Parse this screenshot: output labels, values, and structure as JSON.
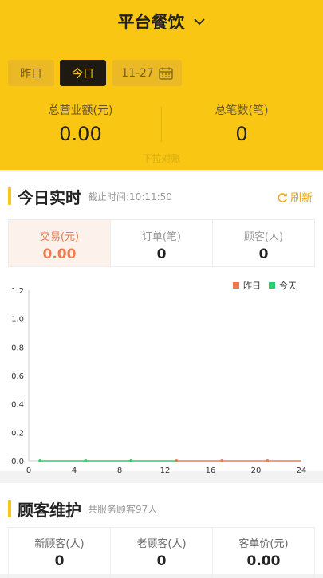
{
  "header": {
    "title": "平台餐饮",
    "tabs": {
      "yesterday": "昨日",
      "today": "今日",
      "date": "11-27"
    },
    "total_revenue": {
      "label": "总营业额(元)",
      "value": "0.00"
    },
    "total_count": {
      "label": "总笔数(笔)",
      "value": "0"
    },
    "pull_hint": "下拉对账"
  },
  "realtime": {
    "title": "今日实时",
    "cutoff": "截止时间:10:11:50",
    "refresh": "刷新",
    "stats": [
      {
        "label": "交易(元)",
        "value": "0.00"
      },
      {
        "label": "订单(笔)",
        "value": "0"
      },
      {
        "label": "顾客(人)",
        "value": "0"
      }
    ]
  },
  "customer": {
    "title": "顾客维护",
    "subtitle": "共服务顾客97人",
    "stats": [
      {
        "label": "新顾客(人)",
        "value": "0"
      },
      {
        "label": "老顾客(人)",
        "value": "0"
      },
      {
        "label": "客单价(元)",
        "value": "0.00"
      }
    ]
  },
  "colors": {
    "brand": "#f8c613",
    "yesterday": "#ef7b4c",
    "today": "#2ecc71"
  },
  "chart_data": {
    "type": "line",
    "x": [
      1,
      5,
      9,
      13,
      17,
      21
    ],
    "xticks": [
      0,
      4,
      8,
      12,
      16,
      20,
      24
    ],
    "yticks": [
      0.0,
      0.2,
      0.4,
      0.6,
      0.8,
      1.0,
      1.2
    ],
    "xlim": [
      0,
      24
    ],
    "ylim": [
      0,
      1.2
    ],
    "grid": false,
    "legend_position": "top-right",
    "series": [
      {
        "name": "昨日",
        "color": "#ef7b4c",
        "points": [
          [
            13,
            0
          ],
          [
            17,
            0
          ],
          [
            21,
            0
          ]
        ],
        "line": [
          [
            13,
            0
          ],
          [
            24,
            0
          ]
        ]
      },
      {
        "name": "今天",
        "color": "#2ecc71",
        "points": [
          [
            1,
            0
          ],
          [
            5,
            0
          ],
          [
            9,
            0
          ]
        ],
        "line": [
          [
            1,
            0
          ],
          [
            13,
            0
          ]
        ]
      }
    ]
  }
}
